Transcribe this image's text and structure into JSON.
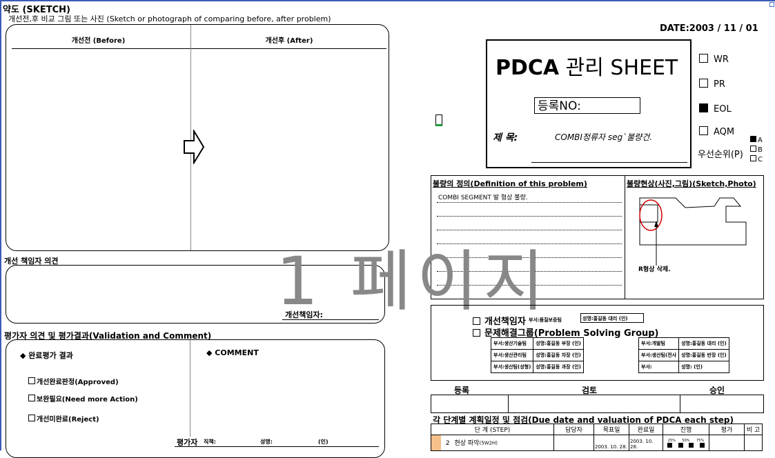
{
  "sketch": {
    "title": "약도 (SKETCH)",
    "subtitle": "개선전,후 비교 그림 또는 사진 (Sketch or photograph of comparing before, after problem)",
    "before_label": "개선전 (Before)",
    "after_label": "개선후 (After)"
  },
  "owner_opinion": {
    "title": "개선 책임자 의견",
    "signature_label": "개선책임자:"
  },
  "evaluation": {
    "title": "평가자  의견 및 평가결과(Validation and Comment)",
    "result_label": "◆ 완료평가 결과",
    "comment_label": "◆ COMMENT",
    "options": [
      "개선완료판정(Approved)",
      "보완필요(Need more Action)",
      "개선미완료(Reject)"
    ],
    "evaluator_label": "평가자",
    "position_label": "직책:",
    "name_label": "성명:",
    "seal_label": "(인)"
  },
  "watermark": "1 페이지",
  "header": {
    "date": "DATE:2003 / 11 / 01",
    "sheet_title_bold": "PDCA",
    "sheet_title_rest": " 관리 SHEET",
    "reg_label": "등록NO:",
    "subject_label": "제 목:",
    "subject_value": "COMBI정류자 seg`불량건."
  },
  "types": [
    {
      "label": "WR",
      "checked": false
    },
    {
      "label": "PR",
      "checked": false
    },
    {
      "label": "EOL",
      "checked": true
    },
    {
      "label": "AQM",
      "checked": false
    }
  ],
  "priority": {
    "label": "우선순위(P)",
    "options": [
      {
        "label": "A",
        "checked": true
      },
      {
        "label": "B",
        "checked": false
      },
      {
        "label": "C",
        "checked": false
      }
    ]
  },
  "definition": {
    "title": "불량의 정의(Definition of this problem)",
    "text": "COMBI SEGMENT 발 형상 불량."
  },
  "phenomenon": {
    "title": "불량현상(사진,그림)(Sketch,Photo)",
    "annotation": "R형상 삭제."
  },
  "responsible": {
    "owner_label": "개선책임자",
    "group_label": "문제해결그룹(Problem Solving Group)",
    "owner_dept": "부서:품질보증팀",
    "owner_name": "성명:홍길동 대리 (인)",
    "rows": [
      {
        "dept_a": "부서:생산기술팀",
        "name_a": "성명:홍길동 부장 (인)",
        "dept_b": "부서:개발팀",
        "name_b": "성명:홍길동 대리 (인)"
      },
      {
        "dept_a": "부서:생산관리팀",
        "name_a": "성명:홍길동 차장 (인)",
        "dept_b": "부서:생산팀(전사",
        "name_b": "성명:홍길동 반장 (인)"
      },
      {
        "dept_a": "부서:생산팀(성형)",
        "name_a": "성명:홍길동 과장 (인)",
        "dept_b": "부서:",
        "name_b": "성명:            (인)"
      }
    ]
  },
  "approval": {
    "register": "등록",
    "review": "검토",
    "approve": "승인"
  },
  "plan": {
    "title": "각 단계별 계획일정 및 점검(Due date and valuation of PDCA each step)",
    "headers": [
      "단 계 (STEP)",
      "담당자",
      "목표일",
      "완료일",
      "진행",
      "평가",
      "비 고"
    ],
    "progress_ticks": [
      "25%",
      "50%",
      "75%"
    ],
    "row": {
      "num": "2",
      "step": "현상 파악",
      "step_suffix": "(5W2H)",
      "target": "2003. 10. 28.",
      "done": "2003. 10. 28."
    }
  }
}
